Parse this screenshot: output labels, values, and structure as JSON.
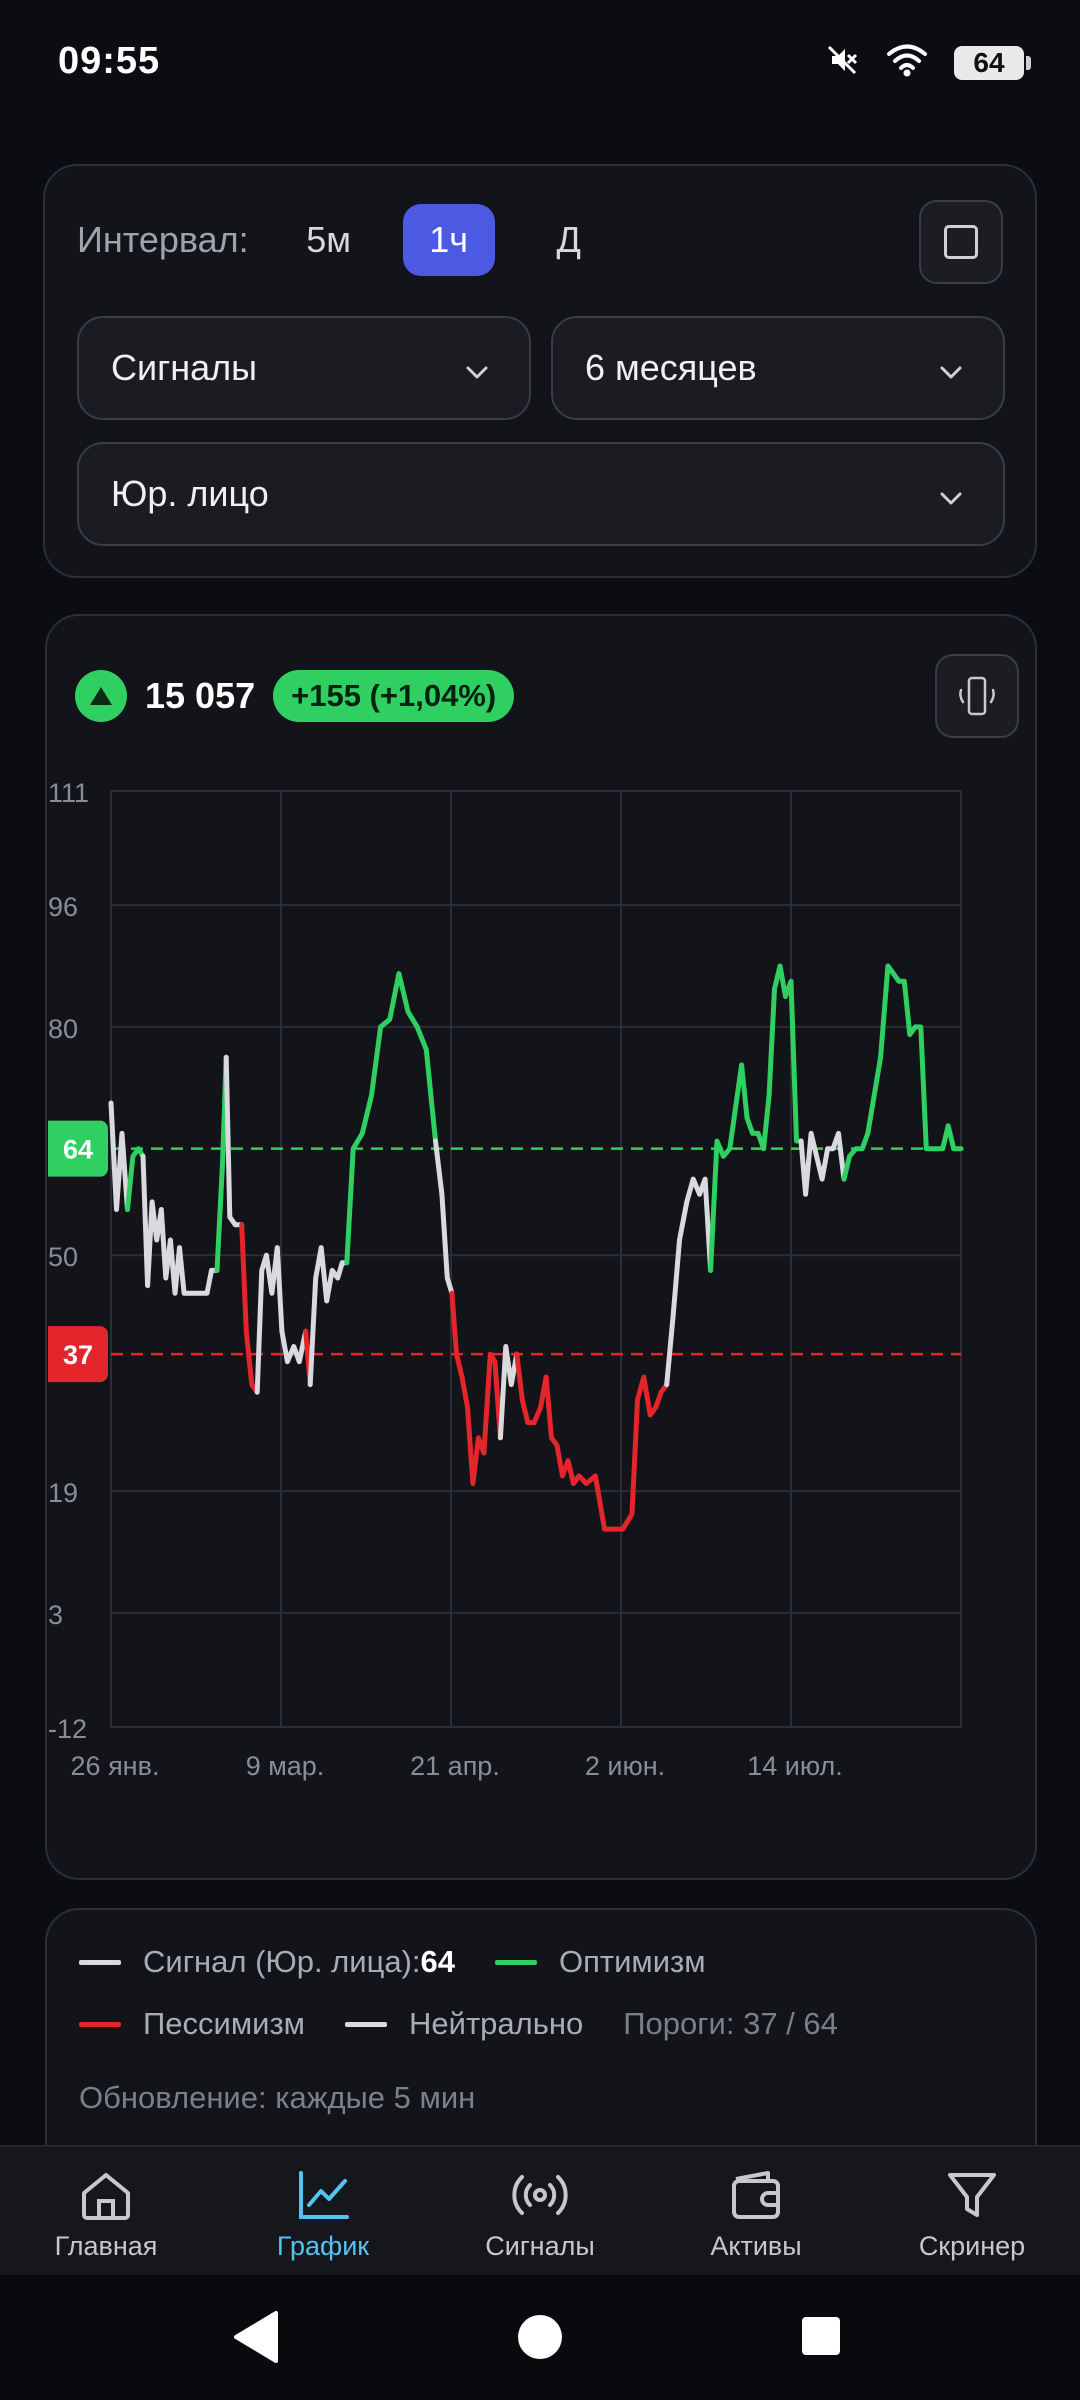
{
  "status": {
    "time": "09:55",
    "battery": "64"
  },
  "controls": {
    "interval_label": "Интервал:",
    "intervals": [
      "5м",
      "1ч",
      "Д"
    ],
    "active_interval": "1ч",
    "indicator_select": "Сигналы",
    "period_select": "6 месяцев",
    "entity_select": "Юр. лицо"
  },
  "summary": {
    "price": "15 057",
    "change": "+155 (+1,04%)"
  },
  "colors": {
    "optimism": "#2fcf62",
    "pessimism": "#e4252b",
    "neutral": "#d9d9de",
    "accent": "#4c5ae3",
    "nav_active": "#54c3f0"
  },
  "chart_data": {
    "type": "line",
    "y_ticks": [
      "111",
      "96",
      "80",
      "50",
      "19",
      "3",
      "-12"
    ],
    "ylim": [
      -12,
      111
    ],
    "x_ticks": [
      "26 янв.",
      "9 мар.",
      "21 апр.",
      "2 июн.",
      "14 июл."
    ],
    "thresholds": {
      "upper": 64,
      "upper_label": "64",
      "lower": 37,
      "lower_label": "37"
    },
    "segments": [
      {
        "state": "neutral",
        "points": [
          [
            0.0,
            70
          ],
          [
            0.6,
            56
          ],
          [
            1.2,
            66
          ],
          [
            1.8,
            56
          ]
        ]
      },
      {
        "state": "optimism",
        "points": [
          [
            1.8,
            56
          ],
          [
            2.4,
            63
          ],
          [
            3.0,
            64
          ],
          [
            3.5,
            63
          ]
        ]
      },
      {
        "state": "neutral",
        "points": [
          [
            3.5,
            63
          ],
          [
            4.0,
            46
          ],
          [
            4.5,
            57
          ],
          [
            5.0,
            52
          ],
          [
            5.5,
            56
          ],
          [
            6.0,
            47
          ],
          [
            6.5,
            52
          ],
          [
            7.0,
            45
          ],
          [
            7.5,
            51
          ],
          [
            8.0,
            45
          ],
          [
            8.8,
            45
          ],
          [
            9.5,
            45
          ],
          [
            10.5,
            45
          ],
          [
            11.0,
            48
          ],
          [
            11.6,
            48
          ]
        ]
      },
      {
        "state": "optimism",
        "points": [
          [
            11.6,
            48
          ],
          [
            12.2,
            62
          ],
          [
            12.6,
            76
          ]
        ]
      },
      {
        "state": "neutral",
        "points": [
          [
            12.6,
            76
          ],
          [
            13.0,
            55
          ],
          [
            13.6,
            54
          ],
          [
            14.3,
            54
          ]
        ]
      },
      {
        "state": "pessimism",
        "points": [
          [
            14.3,
            54
          ],
          [
            14.8,
            40
          ],
          [
            15.4,
            33
          ],
          [
            16.0,
            32
          ]
        ]
      },
      {
        "state": "neutral",
        "points": [
          [
            16.0,
            32
          ],
          [
            16.5,
            48
          ],
          [
            17.0,
            50
          ],
          [
            17.6,
            45
          ],
          [
            18.2,
            51
          ],
          [
            18.7,
            40
          ],
          [
            19.3,
            36
          ],
          [
            20.0,
            38
          ],
          [
            20.6,
            36
          ],
          [
            21.3,
            40
          ]
        ]
      },
      {
        "state": "pessimism",
        "points": [
          [
            21.3,
            40
          ],
          [
            21.8,
            33
          ]
        ]
      },
      {
        "state": "neutral",
        "points": [
          [
            21.8,
            33
          ],
          [
            22.4,
            47
          ],
          [
            23.0,
            51
          ],
          [
            23.6,
            44
          ],
          [
            24.2,
            48
          ],
          [
            24.8,
            47
          ],
          [
            25.3,
            49
          ],
          [
            25.8,
            49
          ]
        ]
      },
      {
        "state": "optimism",
        "points": [
          [
            25.8,
            49
          ],
          [
            26.5,
            64
          ],
          [
            27.5,
            66
          ],
          [
            28.5,
            71
          ],
          [
            29.5,
            80
          ],
          [
            30.5,
            81
          ],
          [
            31.5,
            87
          ],
          [
            32.5,
            82
          ],
          [
            33.5,
            80
          ],
          [
            34.5,
            77
          ],
          [
            35.5,
            65
          ]
        ]
      },
      {
        "state": "neutral",
        "points": [
          [
            35.5,
            65
          ],
          [
            36.2,
            58
          ],
          [
            36.8,
            47
          ],
          [
            37.3,
            45
          ]
        ]
      },
      {
        "state": "pessimism",
        "points": [
          [
            37.3,
            45
          ],
          [
            37.8,
            37
          ],
          [
            38.4,
            34
          ],
          [
            39.0,
            30
          ],
          [
            39.6,
            20
          ],
          [
            40.2,
            26
          ],
          [
            40.8,
            24
          ],
          [
            41.5,
            37
          ],
          [
            42.0,
            36
          ],
          [
            42.6,
            26
          ]
        ]
      },
      {
        "state": "neutral",
        "points": [
          [
            42.6,
            26
          ],
          [
            43.2,
            38
          ],
          [
            43.8,
            33
          ],
          [
            44.4,
            37
          ]
        ]
      },
      {
        "state": "pessimism",
        "points": [
          [
            44.4,
            37
          ],
          [
            45.0,
            31
          ],
          [
            45.6,
            28
          ],
          [
            46.3,
            28
          ],
          [
            47.0,
            30
          ],
          [
            47.6,
            34
          ],
          [
            48.2,
            26
          ],
          [
            48.8,
            25
          ],
          [
            49.4,
            21
          ],
          [
            50.0,
            23
          ],
          [
            50.6,
            20
          ],
          [
            51.2,
            21
          ],
          [
            52.0,
            20
          ],
          [
            53.0,
            21
          ],
          [
            54.0,
            14
          ],
          [
            55.0,
            14
          ],
          [
            56.0,
            14
          ],
          [
            57.0,
            16
          ],
          [
            57.6,
            31
          ],
          [
            58.3,
            34
          ],
          [
            59.0,
            29
          ],
          [
            59.6,
            30
          ],
          [
            60.2,
            32
          ],
          [
            60.8,
            33
          ]
        ]
      },
      {
        "state": "neutral",
        "points": [
          [
            60.8,
            33
          ],
          [
            61.5,
            42
          ],
          [
            62.2,
            52
          ],
          [
            63.0,
            57
          ],
          [
            63.7,
            60
          ],
          [
            64.4,
            58
          ],
          [
            65.0,
            60
          ],
          [
            65.6,
            48
          ]
        ]
      },
      {
        "state": "optimism",
        "points": [
          [
            65.6,
            48
          ],
          [
            66.3,
            65
          ],
          [
            67.0,
            63
          ],
          [
            67.7,
            64
          ],
          [
            68.4,
            70
          ],
          [
            69.0,
            75
          ],
          [
            69.6,
            68
          ],
          [
            70.2,
            66
          ],
          [
            70.8,
            66
          ],
          [
            71.4,
            64
          ],
          [
            72.0,
            71
          ],
          [
            72.6,
            85
          ],
          [
            73.2,
            88
          ],
          [
            73.8,
            84
          ],
          [
            74.4,
            86
          ],
          [
            75.0,
            65
          ],
          [
            75.5,
            65
          ]
        ]
      },
      {
        "state": "neutral",
        "points": [
          [
            75.5,
            65
          ],
          [
            76.0,
            58
          ],
          [
            76.6,
            66
          ],
          [
            77.2,
            63
          ],
          [
            77.8,
            60
          ],
          [
            78.4,
            64
          ],
          [
            79.0,
            64
          ],
          [
            79.6,
            66
          ],
          [
            80.2,
            60
          ]
        ]
      },
      {
        "state": "optimism",
        "points": [
          [
            80.2,
            60
          ],
          [
            80.8,
            63
          ],
          [
            81.5,
            64
          ],
          [
            82.2,
            64
          ],
          [
            82.8,
            66
          ],
          [
            83.5,
            71
          ],
          [
            84.2,
            76
          ],
          [
            85.0,
            88
          ],
          [
            85.6,
            87
          ],
          [
            86.2,
            86
          ],
          [
            86.8,
            86
          ],
          [
            87.4,
            79
          ],
          [
            88.0,
            80
          ],
          [
            88.6,
            80
          ],
          [
            89.2,
            64
          ],
          [
            89.8,
            64
          ],
          [
            90.4,
            64
          ],
          [
            91.0,
            64
          ],
          [
            91.6,
            67
          ],
          [
            92.2,
            64
          ],
          [
            93.0,
            64
          ]
        ]
      }
    ]
  },
  "legend": {
    "signal_label": "Сигнал (Юр. лица)",
    "signal_sep": ": ",
    "signal_value": "64",
    "optimism": "Оптимизм",
    "pessimism": "Пессимизм",
    "neutral": "Нейтрально",
    "thresholds": "Пороги: 37 / 64",
    "update": "Обновление: каждые 5 мин"
  },
  "nav": {
    "items": [
      {
        "label": "Главная",
        "icon": "home-icon"
      },
      {
        "label": "График",
        "icon": "chart-icon",
        "active": true
      },
      {
        "label": "Сигналы",
        "icon": "broadcast-icon"
      },
      {
        "label": "Активы",
        "icon": "wallet-icon"
      },
      {
        "label": "Скринер",
        "icon": "filter-icon"
      }
    ]
  }
}
